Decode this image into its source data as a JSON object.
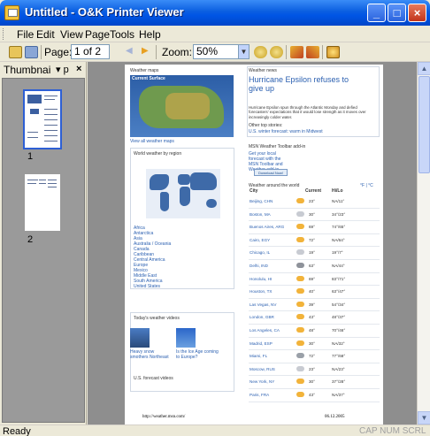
{
  "window": {
    "title": "Untitled - O&K Printer Viewer"
  },
  "menu": [
    "File",
    "Edit",
    "View",
    "Page",
    "Tools",
    "Help"
  ],
  "toolbar": {
    "page_label": "Page:",
    "page_value": "1 of 2",
    "zoom_label": "Zoom:",
    "zoom_value": "50%"
  },
  "thumbnails": {
    "header": "Thumbnai",
    "pin": "▾ p",
    "close": "×",
    "pages": [
      "1",
      "2"
    ]
  },
  "document": {
    "left_col": {
      "weather_maps": "Weather maps",
      "current_conditions": "Current Surface",
      "view_all_maps": "View all weather maps",
      "world_weather": "World weather by region",
      "regions": [
        "Africa",
        "Antarctica",
        "Asia",
        "Australia / Oceania",
        "Canada",
        "Caribbean",
        "Central America",
        "Europe",
        "Mexico",
        "Middle East",
        "South America",
        "United States"
      ],
      "videos_title": "Today's weather videos",
      "video1_caption": "Heavy snow smothers Northeast",
      "video2_caption": "Is the Ice Age coming to Europe?",
      "us_forecast_videos": "U.S. forecast videos"
    },
    "right_col": {
      "news_header": "Weather news",
      "headline": "Hurricane Epsilon refuses to give up",
      "story": "Hurricane Epsilon spun through the Atlantic Monday and defied forecasters' expectations that it would lose strength as it moves over increasingly colder water.",
      "other_stories": "Other top stories:",
      "other_story_link": "U.S. winter forecast: warm in Midwest",
      "toolbar_addin": "MSN Weather Toolbar add-in",
      "addin_text": "Get your local forecast with the MSN Toolbar and Weather add-in.",
      "download": "Download Now!",
      "around_world": "Weather around the world",
      "units": "°F | °C",
      "col_city": "City",
      "col_current": "Current",
      "col_hilo": "Hi/Lo",
      "cities": [
        {
          "city": "Beijing, CHN",
          "cur": "23°",
          "hilo": "NA/11°"
        },
        {
          "city": "Boston, MA",
          "cur": "30°",
          "hilo": "34°/23°"
        },
        {
          "city": "Buenos Aires, ARG",
          "cur": "69°",
          "hilo": "74°/65°"
        },
        {
          "city": "Cairo, EGY",
          "cur": "72°",
          "hilo": "NA/64°"
        },
        {
          "city": "Chicago, IL",
          "cur": "19°",
          "hilo": "19°/7°"
        },
        {
          "city": "Delhi, IND",
          "cur": "63°",
          "hilo": "NA/44°"
        },
        {
          "city": "Honolulu, HI",
          "cur": "69°",
          "hilo": "83°/71°"
        },
        {
          "city": "Houston, TX",
          "cur": "40°",
          "hilo": "63°/47°"
        },
        {
          "city": "Las Vegas, NV",
          "cur": "39°",
          "hilo": "54°/34°"
        },
        {
          "city": "London, GBR",
          "cur": "43°",
          "hilo": "48°/37°"
        },
        {
          "city": "Los Angeles, CA",
          "cur": "48°",
          "hilo": "70°/46°"
        },
        {
          "city": "Madrid, ESP",
          "cur": "30°",
          "hilo": "NA/32°"
        },
        {
          "city": "Miami, FL",
          "cur": "72°",
          "hilo": "77°/68°"
        },
        {
          "city": "Moscow, RUS",
          "cur": "23°",
          "hilo": "NA/23°"
        },
        {
          "city": "New York, NY",
          "cur": "30°",
          "hilo": "37°/28°"
        },
        {
          "city": "Paris, FRA",
          "cur": "43°",
          "hilo": "NA/37°"
        }
      ]
    },
    "footer_url": "http://weather.msn.com/",
    "footer_date": "06.12.2005"
  },
  "status": {
    "text": "Ready",
    "indicators": "CAP NUM SCRL"
  }
}
